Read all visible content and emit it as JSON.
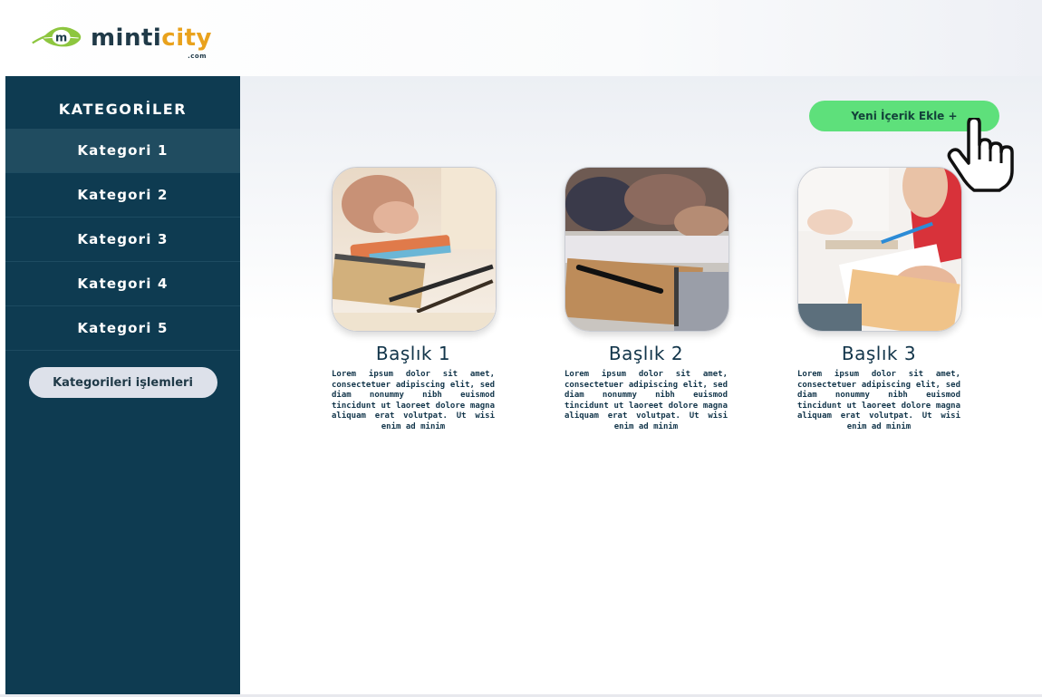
{
  "logo": {
    "text_main": "minti",
    "text_accent": "city",
    "suffix": ".com",
    "mark_letter": "m"
  },
  "sidebar": {
    "title": "KATEGORİLER",
    "items": [
      {
        "label": "Kategori 1",
        "active": true
      },
      {
        "label": "Kategori 2",
        "active": false
      },
      {
        "label": "Kategori 3",
        "active": false
      },
      {
        "label": "Kategori 4",
        "active": false
      },
      {
        "label": "Kategori 5",
        "active": false
      }
    ],
    "actions_label": "Kategorileri işlemleri"
  },
  "main": {
    "add_button_label": "Yeni İçerik Ekle +",
    "cards": [
      {
        "title": "Başlık 1",
        "text": "Lorem ipsum dolor sit amet, consectetuer adipiscing elit, sed diam nonummy nibh euismod tincidunt ut laoreet dolore magna aliquam erat volutpat. Ut wisi enim ad minim"
      },
      {
        "title": "Başlık 2",
        "text": "Lorem ipsum dolor sit amet, consectetuer adipiscing elit, sed diam nonummy nibh euismod tincidunt ut laoreet dolore magna aliquam erat volutpat. Ut wisi enim ad minim"
      },
      {
        "title": "Başlık 3",
        "text": "Lorem ipsum dolor sit amet, consectetuer adipiscing elit, sed diam nonummy nibh euismod tincidunt ut laoreet dolore magna aliquam erat volutpat. Ut wisi enim ad minim"
      }
    ]
  },
  "colors": {
    "sidebar_bg": "#0e3b51",
    "sidebar_active": "#204c60",
    "add_button": "#5ee07b",
    "logo_green": "#8dc63f",
    "logo_accent": "#e9a21d",
    "text_dark": "#12354a"
  },
  "icons": {
    "logo": "leaf-logo-icon",
    "cursor": "hand-pointer-icon"
  }
}
